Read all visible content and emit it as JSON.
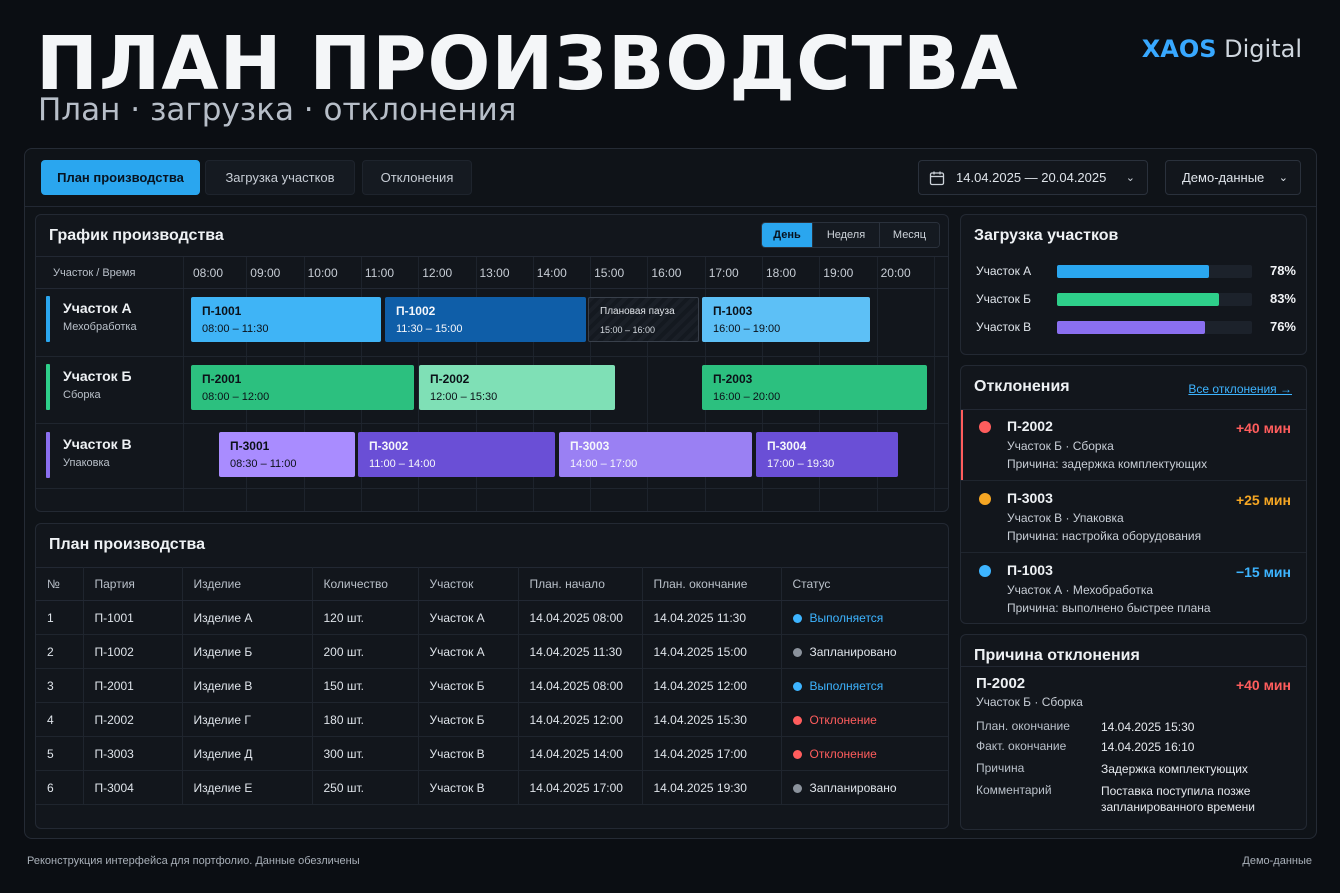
{
  "hero": {
    "title": "ПЛАН ПРОИЗВОДСТВА",
    "subtitle": "План · загрузка · отклонения"
  },
  "brand": {
    "part1": "XAOS",
    "part2": " Digital"
  },
  "tabs": [
    {
      "label": "План производства",
      "active": true
    },
    {
      "label": "Загрузка участков",
      "active": false
    },
    {
      "label": "Отклонения",
      "active": false
    }
  ],
  "date_range": "14.04.2025 — 20.04.2025",
  "data_mode": "Демо-данные",
  "gantt": {
    "title": "График производства",
    "views": [
      "День",
      "Неделя",
      "Месяц"
    ],
    "active_view": "День",
    "corner_label": "Участок / Время",
    "hours": [
      "08:00",
      "09:00",
      "10:00",
      "11:00",
      "12:00",
      "13:00",
      "14:00",
      "15:00",
      "16:00",
      "17:00",
      "18:00",
      "19:00",
      "20:00"
    ],
    "rows": [
      {
        "name": "Участок А",
        "sub": "Мехобработка",
        "color": "#2aa6ef"
      },
      {
        "name": "Участок Б",
        "sub": "Сборка",
        "color": "#2ecf8a"
      },
      {
        "name": "Участок В",
        "sub": "Упаковка",
        "color": "#8a6ff0"
      }
    ],
    "tasks": [
      {
        "code": "П-1001",
        "time": "08:00 – 11:30"
      },
      {
        "code": "П-1002",
        "time": "11:30 – 15:00"
      },
      {
        "code": "Плановая пауза",
        "time": "15:00 – 16:00"
      },
      {
        "code": "П-1003",
        "time": "16:00 – 19:00"
      },
      {
        "code": "П-2001",
        "time": "08:00 – 12:00"
      },
      {
        "code": "П-2002",
        "time": "12:00 – 15:30"
      },
      {
        "code": "П-2003",
        "time": "16:00 – 20:00"
      },
      {
        "code": "П-3001",
        "time": "08:30 – 11:00"
      },
      {
        "code": "П-3002",
        "time": "11:00 – 14:00"
      },
      {
        "code": "П-3003",
        "time": "14:00 – 17:00"
      },
      {
        "code": "П-3004",
        "time": "17:00 – 19:30"
      }
    ]
  },
  "plan": {
    "title": "План производства",
    "columns": [
      "№",
      "Партия",
      "Изделие",
      "Количество",
      "Участок",
      "План. начало",
      "План. окончание",
      "Статус"
    ],
    "rows": [
      [
        "1",
        "П-1001",
        "Изделие А",
        "120 шт.",
        "Участок А",
        "14.04.2025 08:00",
        "14.04.2025 11:30",
        "Выполняется"
      ],
      [
        "2",
        "П-1002",
        "Изделие Б",
        "200 шт.",
        "Участок А",
        "14.04.2025 11:30",
        "14.04.2025 15:00",
        "Запланировано"
      ],
      [
        "3",
        "П-2001",
        "Изделие В",
        "150 шт.",
        "Участок Б",
        "14.04.2025 08:00",
        "14.04.2025 12:00",
        "Выполняется"
      ],
      [
        "4",
        "П-2002",
        "Изделие Г",
        "180 шт.",
        "Участок Б",
        "14.04.2025 12:00",
        "14.04.2025 15:30",
        "Отклонение"
      ],
      [
        "5",
        "П-3003",
        "Изделие Д",
        "300 шт.",
        "Участок В",
        "14.04.2025 14:00",
        "14.04.2025 17:00",
        "Отклонение"
      ],
      [
        "6",
        "П-3004",
        "Изделие Е",
        "250 шт.",
        "Участок В",
        "14.04.2025 17:00",
        "14.04.2025 19:30",
        "Запланировано"
      ]
    ]
  },
  "load": {
    "title": "Загрузка участков",
    "items": [
      {
        "name": "Участок А",
        "pct": "78%",
        "value": 78,
        "color": "#2aa6ef"
      },
      {
        "name": "Участок Б",
        "pct": "83%",
        "value": 83,
        "color": "#2ecf8a"
      },
      {
        "name": "Участок В",
        "pct": "76%",
        "value": 76,
        "color": "#8a6ff0"
      }
    ]
  },
  "deviations": {
    "title": "Отклонения",
    "link": "Все отклонения →",
    "items": [
      {
        "code": "П-2002",
        "area": "Участок Б · Сборка",
        "reason": "Причина: задержка комплектующих",
        "delta": "+40 мин",
        "color": "#ff5d5d"
      },
      {
        "code": "П-3003",
        "area": "Участок В · Упаковка",
        "reason": "Причина: настройка оборудования",
        "delta": "+25 мин",
        "color": "#f5a623"
      },
      {
        "code": "П-1003",
        "area": "Участок А · Мехобработка",
        "reason": "Причина: выполнено быстрее плана",
        "delta": "−15 мин",
        "color": "#3db4ff"
      }
    ]
  },
  "reason": {
    "title": "Причина отклонения",
    "code": "П-2002",
    "delta": "+40 мин",
    "area": "Участок Б · Сборка",
    "fields": [
      {
        "k": "План. окончание",
        "v": "14.04.2025 15:30"
      },
      {
        "k": "Факт. окончание",
        "v": "14.04.2025 16:10"
      },
      {
        "k": "Причина",
        "v": "Задержка комплектующих"
      },
      {
        "k": "Комментарий",
        "v": "Поставка поступила позже запланированного времени"
      }
    ]
  },
  "footer": {
    "left": "Реконструкция интерфейса для портфолио. Данные обезличены",
    "right": "Демо-данные"
  }
}
